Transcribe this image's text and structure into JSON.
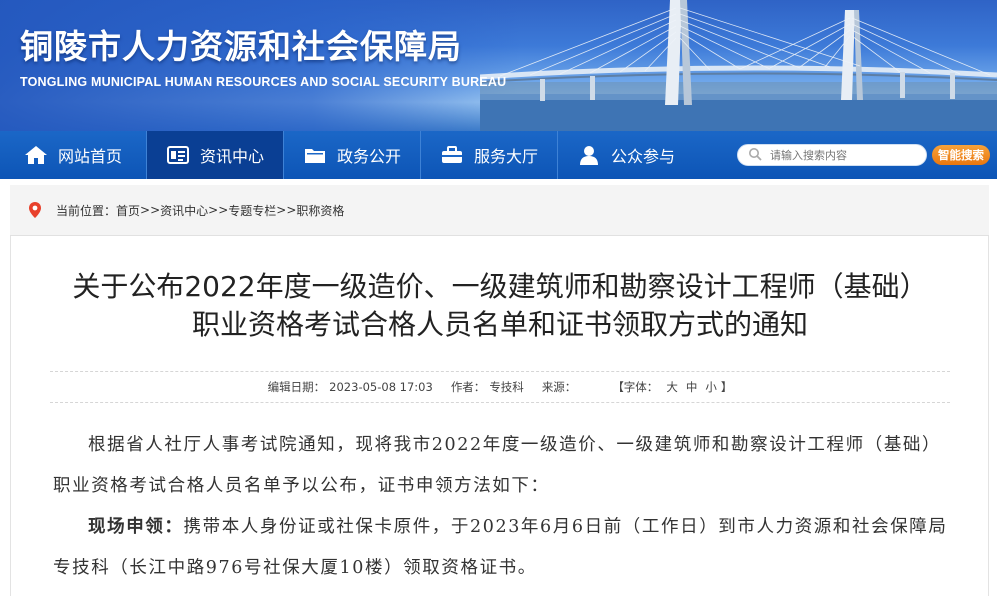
{
  "header": {
    "site_title": "铜陵市人力资源和社会保障局",
    "site_subtitle": "TONGLING MUNICIPAL HUMAN RESOURCES AND SOCIAL SECURITY BUREAU"
  },
  "nav": {
    "items": [
      {
        "label": "网站首页",
        "icon": "home-icon"
      },
      {
        "label": "资讯中心",
        "icon": "news-icon"
      },
      {
        "label": "政务公开",
        "icon": "folder-icon"
      },
      {
        "label": "服务大厅",
        "icon": "briefcase-icon"
      },
      {
        "label": "公众参与",
        "icon": "user-icon"
      }
    ],
    "active_index": 1,
    "search_placeholder": "请输入搜索内容",
    "search_button": "智能搜索"
  },
  "breadcrumb": {
    "prefix": "当前位置：",
    "items": [
      "首页",
      "资讯中心",
      "专题专栏",
      "职称资格"
    ],
    "sep": ">>"
  },
  "article": {
    "title": "关于公布2022年度一级造价、一级建筑师和勘察设计工程师（基础）职业资格考试合格人员名单和证书领取方式的通知",
    "edit_date_label": "编辑日期：",
    "edit_date": "2023-05-08 17:03",
    "author_label": "作者：",
    "author": "专技科",
    "source_label": "来源：",
    "source": "",
    "font_label": "【字体：",
    "font_large": "大",
    "font_medium": "中",
    "font_small": "小",
    "font_close": "】",
    "para1": "根据省人社厅人事考试院通知，现将我市2022年度一级造价、一级建筑师和勘察设计工程师（基础）职业资格考试合格人员名单予以公布，证书申领方法如下：",
    "para2_label": "现场申领：",
    "para2_text": "携带本人身份证或社保卡原件，于2023年6月6日前（工作日）到市人力资源和社会保障局专技科（长江中路976号社保大厦10楼）领取资格证书。"
  },
  "colors": {
    "nav_bg": "#0d55b6",
    "nav_active": "#0a3f94",
    "search_button": "#e9770f",
    "location_pin": "#e8412c"
  }
}
